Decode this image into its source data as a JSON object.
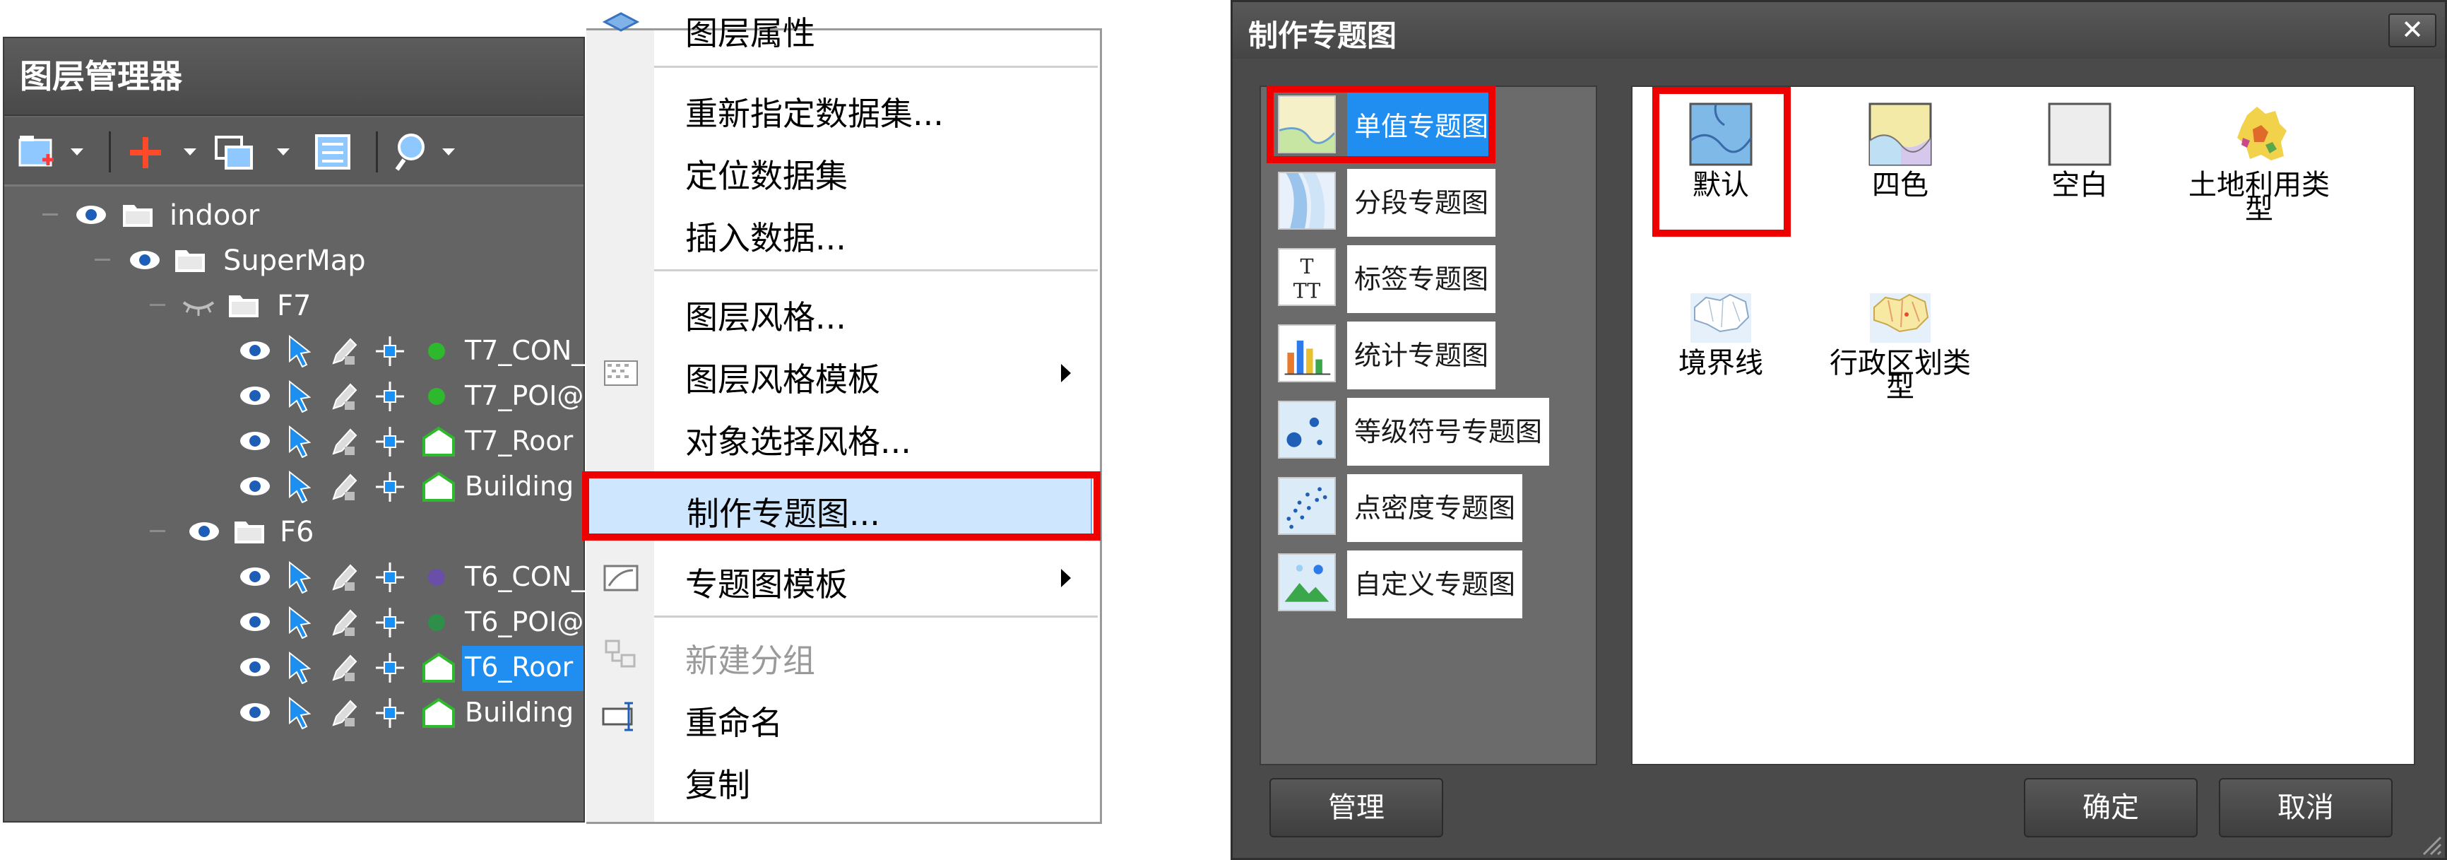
{
  "layer_manager": {
    "title": "图层管理器",
    "tree": {
      "root": "indoor",
      "map": "SuperMap",
      "floor7": "F7",
      "t7_con": "T7_CON_",
      "t7_poi": "T7_POI@",
      "t7_room": "T7_Roor",
      "building7": "Building",
      "floor6": "F6",
      "t6_con": "T6_CON_",
      "t6_poi": "T6_POI@",
      "t6_room": "T6_Roor",
      "building6": "Building"
    }
  },
  "context_menu": {
    "top_partial": "图层属性",
    "respecify_dataset": "重新指定数据集...",
    "locate_dataset": "定位数据集",
    "insert_data": "插入数据...",
    "layer_style": "图层风格...",
    "layer_style_template": "图层风格模板",
    "object_select_style": "对象选择风格...",
    "make_thematic_map": "制作专题图...",
    "thematic_template": "专题图模板",
    "new_group": "新建分组",
    "rename": "重命名",
    "copy": "复制"
  },
  "dialog": {
    "title": "制作专题图",
    "close_glyph": "✕",
    "map_types": [
      "单值专题图",
      "分段专题图",
      "标签专题图",
      "统计专题图",
      "等级符号专题图",
      "点密度专题图",
      "自定义专题图"
    ],
    "selected_type": "单值专题图",
    "styles": {
      "default": "默认",
      "four_color": "四色",
      "blank": "空白",
      "land_use": "土地利用类型",
      "boundary": "境界线",
      "admin_division": "行政区划类型"
    },
    "selected_style": "默认",
    "buttons": {
      "manage": "管理",
      "ok": "确定",
      "cancel": "取消"
    }
  },
  "colors": {
    "panel_bg": "#646464",
    "selection_blue": "#1f8ef0",
    "highlight_red": "#ee0000",
    "menu_hover": "#cfe6ff",
    "layer_green": "#2eb82e",
    "layer_purple": "#6a4fa8"
  },
  "icons": {
    "visible": "eye-icon",
    "folder": "folder-icon",
    "selectable": "cursor-icon",
    "editable": "pencil-icon",
    "snappable": "snap-icon",
    "point_layer": "dot-icon",
    "region_layer": "house-icon"
  }
}
